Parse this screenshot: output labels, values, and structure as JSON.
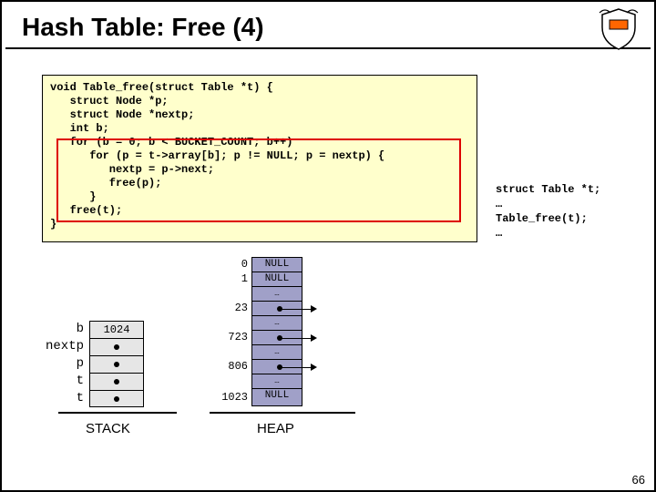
{
  "title": "Hash Table: Free (4)",
  "code": "void Table_free(struct Table *t) {\n   struct Node *p;\n   struct Node *nextp;\n   int b;\n   for (b = 0; b < BUCKET_COUNT; b++)\n      for (p = t->array[b]; p != NULL; p = nextp) {\n         nextp = p->next;\n         free(p);\n      }\n   free(t);\n}",
  "sidecode": "struct Table *t;\n…\nTable_free(t);\n…",
  "stack": {
    "labels": [
      "b",
      "nextp",
      "p",
      "t",
      "t"
    ],
    "cells": [
      "1024",
      "",
      "",
      "",
      ""
    ],
    "ground_label": "STACK"
  },
  "heap": {
    "ground_label": "HEAP",
    "rows": [
      {
        "idx": "0",
        "val": "NULL"
      },
      {
        "idx": "1",
        "val": "NULL"
      },
      {
        "idx": "",
        "val": "…"
      },
      {
        "idx": "23",
        "val": ""
      },
      {
        "idx": "",
        "val": "…"
      },
      {
        "idx": "723",
        "val": ""
      },
      {
        "idx": "",
        "val": "…"
      },
      {
        "idx": "806",
        "val": ""
      },
      {
        "idx": "",
        "val": "…"
      },
      {
        "idx": "1023",
        "val": "NULL"
      }
    ]
  },
  "pagenum": "66"
}
